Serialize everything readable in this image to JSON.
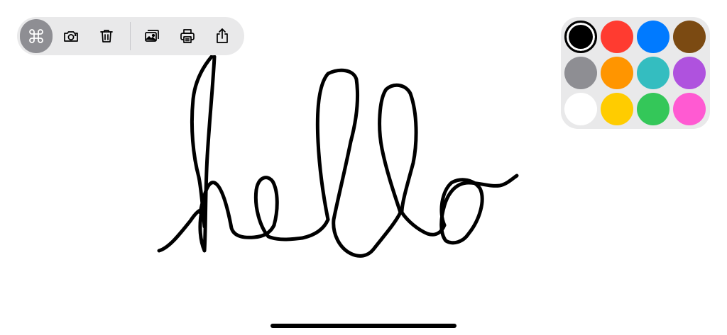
{
  "toolbar": {
    "buttons": [
      {
        "id": "command",
        "icon": "command-icon",
        "active": true
      },
      {
        "id": "camera",
        "icon": "camera-icon",
        "active": false
      },
      {
        "id": "trash",
        "icon": "trash-icon",
        "active": false
      },
      {
        "id": "photos",
        "icon": "photo-library-icon",
        "active": false
      },
      {
        "id": "print",
        "icon": "printer-icon",
        "active": false
      },
      {
        "id": "share",
        "icon": "share-icon",
        "active": false
      }
    ],
    "active_color": "#8e8e93",
    "icon_color_active": "#ffffff",
    "icon_color": "#000000"
  },
  "palette": {
    "selected": "#000000",
    "colors": [
      {
        "name": "black",
        "hex": "#000000"
      },
      {
        "name": "red",
        "hex": "#ff3b30"
      },
      {
        "name": "blue",
        "hex": "#007aff"
      },
      {
        "name": "brown",
        "hex": "#7b4a12"
      },
      {
        "name": "gray",
        "hex": "#8e8e93"
      },
      {
        "name": "orange",
        "hex": "#ff9500"
      },
      {
        "name": "teal",
        "hex": "#34bdc0"
      },
      {
        "name": "purple",
        "hex": "#af52de"
      },
      {
        "name": "white",
        "hex": "#ffffff"
      },
      {
        "name": "yellow",
        "hex": "#ffcc00"
      },
      {
        "name": "green",
        "hex": "#34c759"
      },
      {
        "name": "pink",
        "hex": "#ff5ad2"
      }
    ]
  },
  "drawing": {
    "stroke_color": "#000000",
    "content": "handwritten-hello"
  }
}
